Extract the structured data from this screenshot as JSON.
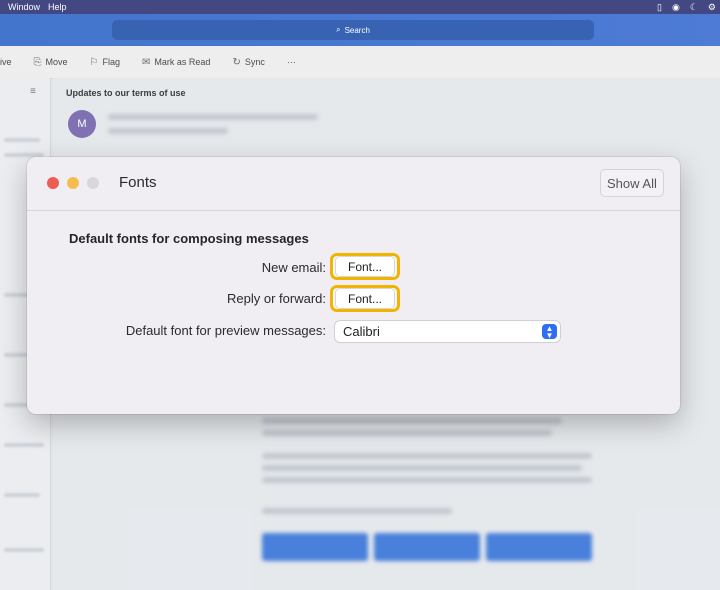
{
  "menubar": {
    "items": [
      "Window",
      "Help"
    ]
  },
  "search": {
    "label": "Search"
  },
  "toolbar": {
    "archive_partial": "ive",
    "move": "Move",
    "flag": "Flag",
    "mark_as_read": "Mark as Read",
    "sync": "Sync",
    "more": "···"
  },
  "message": {
    "subject": "Updates to our terms of use",
    "avatar_initial": "M"
  },
  "dialog": {
    "title": "Fonts",
    "show_all": "Show All",
    "section_heading": "Default fonts for composing messages",
    "new_email_label": "New email:",
    "new_email_button": "Font...",
    "reply_label": "Reply or forward:",
    "reply_button": "Font...",
    "preview_label": "Default font for preview messages:",
    "preview_value": "Calibri"
  },
  "colors": {
    "highlight": "#f2b400",
    "close": "#ee5c56",
    "minimize": "#f5bd4f",
    "zoom_disabled": "#d9d7dc",
    "accent": "#2d6ef2"
  }
}
